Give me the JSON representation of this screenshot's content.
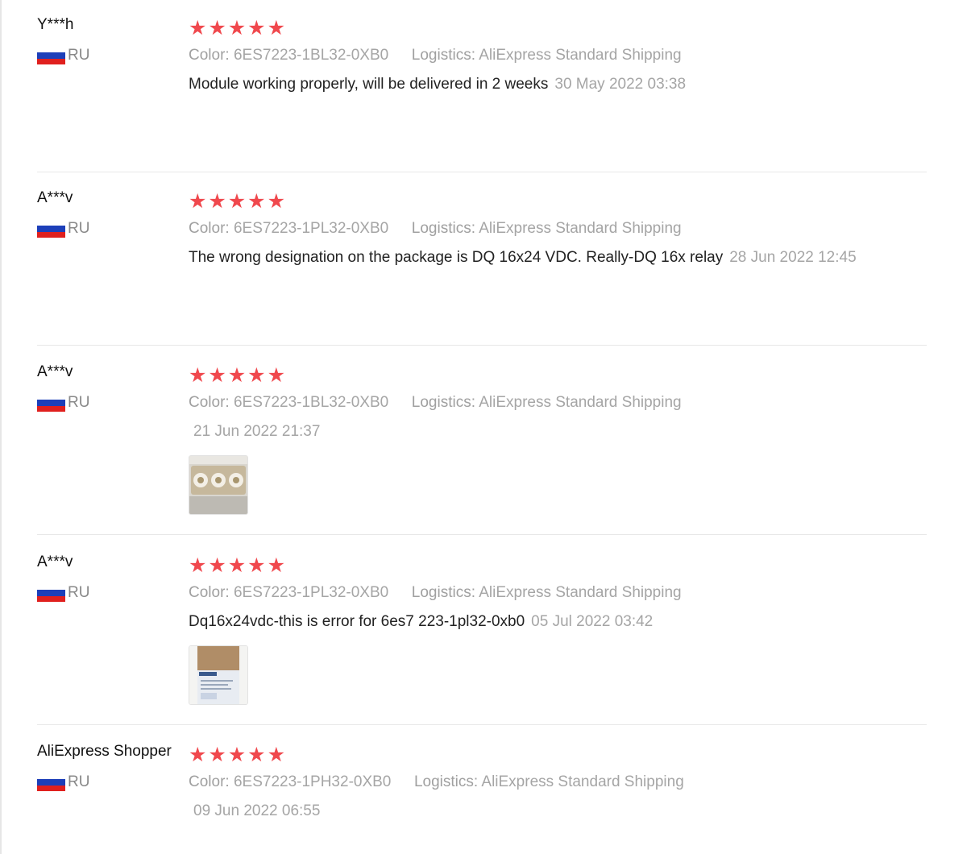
{
  "reviews": [
    {
      "user": "Y***h",
      "country": "RU",
      "color_label": "Color:",
      "color_value": "6ES7223-1BL32-0XB0",
      "logistics_label": "Logistics:",
      "logistics_value": "AliExpress Standard Shipping",
      "text": "Module working properly, will be delivered in 2 weeks",
      "date": "30 May 2022 03:38",
      "rating": 5
    },
    {
      "user": "A***v",
      "country": "RU",
      "color_label": "Color:",
      "color_value": "6ES7223-1PL32-0XB0",
      "logistics_label": "Logistics:",
      "logistics_value": "AliExpress Standard Shipping",
      "text": "The wrong designation on the package is DQ 16x24 VDC. Really-DQ 16x relay",
      "date": "28 Jun 2022 12:45",
      "rating": 5
    },
    {
      "user": "A***v",
      "country": "RU",
      "color_label": "Color:",
      "color_value": "6ES7223-1BL32-0XB0",
      "logistics_label": "Logistics:",
      "logistics_value": "AliExpress Standard Shipping",
      "text": "",
      "date": "21 Jun 2022 21:37",
      "rating": 5
    },
    {
      "user": "A***v",
      "country": "RU",
      "color_label": "Color:",
      "color_value": "6ES7223-1PL32-0XB0",
      "logistics_label": "Logistics:",
      "logistics_value": "AliExpress Standard Shipping",
      "text": "Dq16x24vdc-this is error for 6es7 223-1pl32-0xb0",
      "date": "05 Jul 2022 03:42",
      "rating": 5
    },
    {
      "user": "AliExpress Shopper",
      "country": "RU",
      "color_label": "Color:",
      "color_value": "6ES7223-1PH32-0XB0",
      "logistics_label": "Logistics:",
      "logistics_value": "AliExpress Standard Shipping",
      "text": "",
      "date": "09 Jun 2022 06:55",
      "rating": 5
    }
  ],
  "colors": {
    "star": "#f0484d",
    "muted_text": "#a5a5a5",
    "separator": "#e8e8e8"
  }
}
